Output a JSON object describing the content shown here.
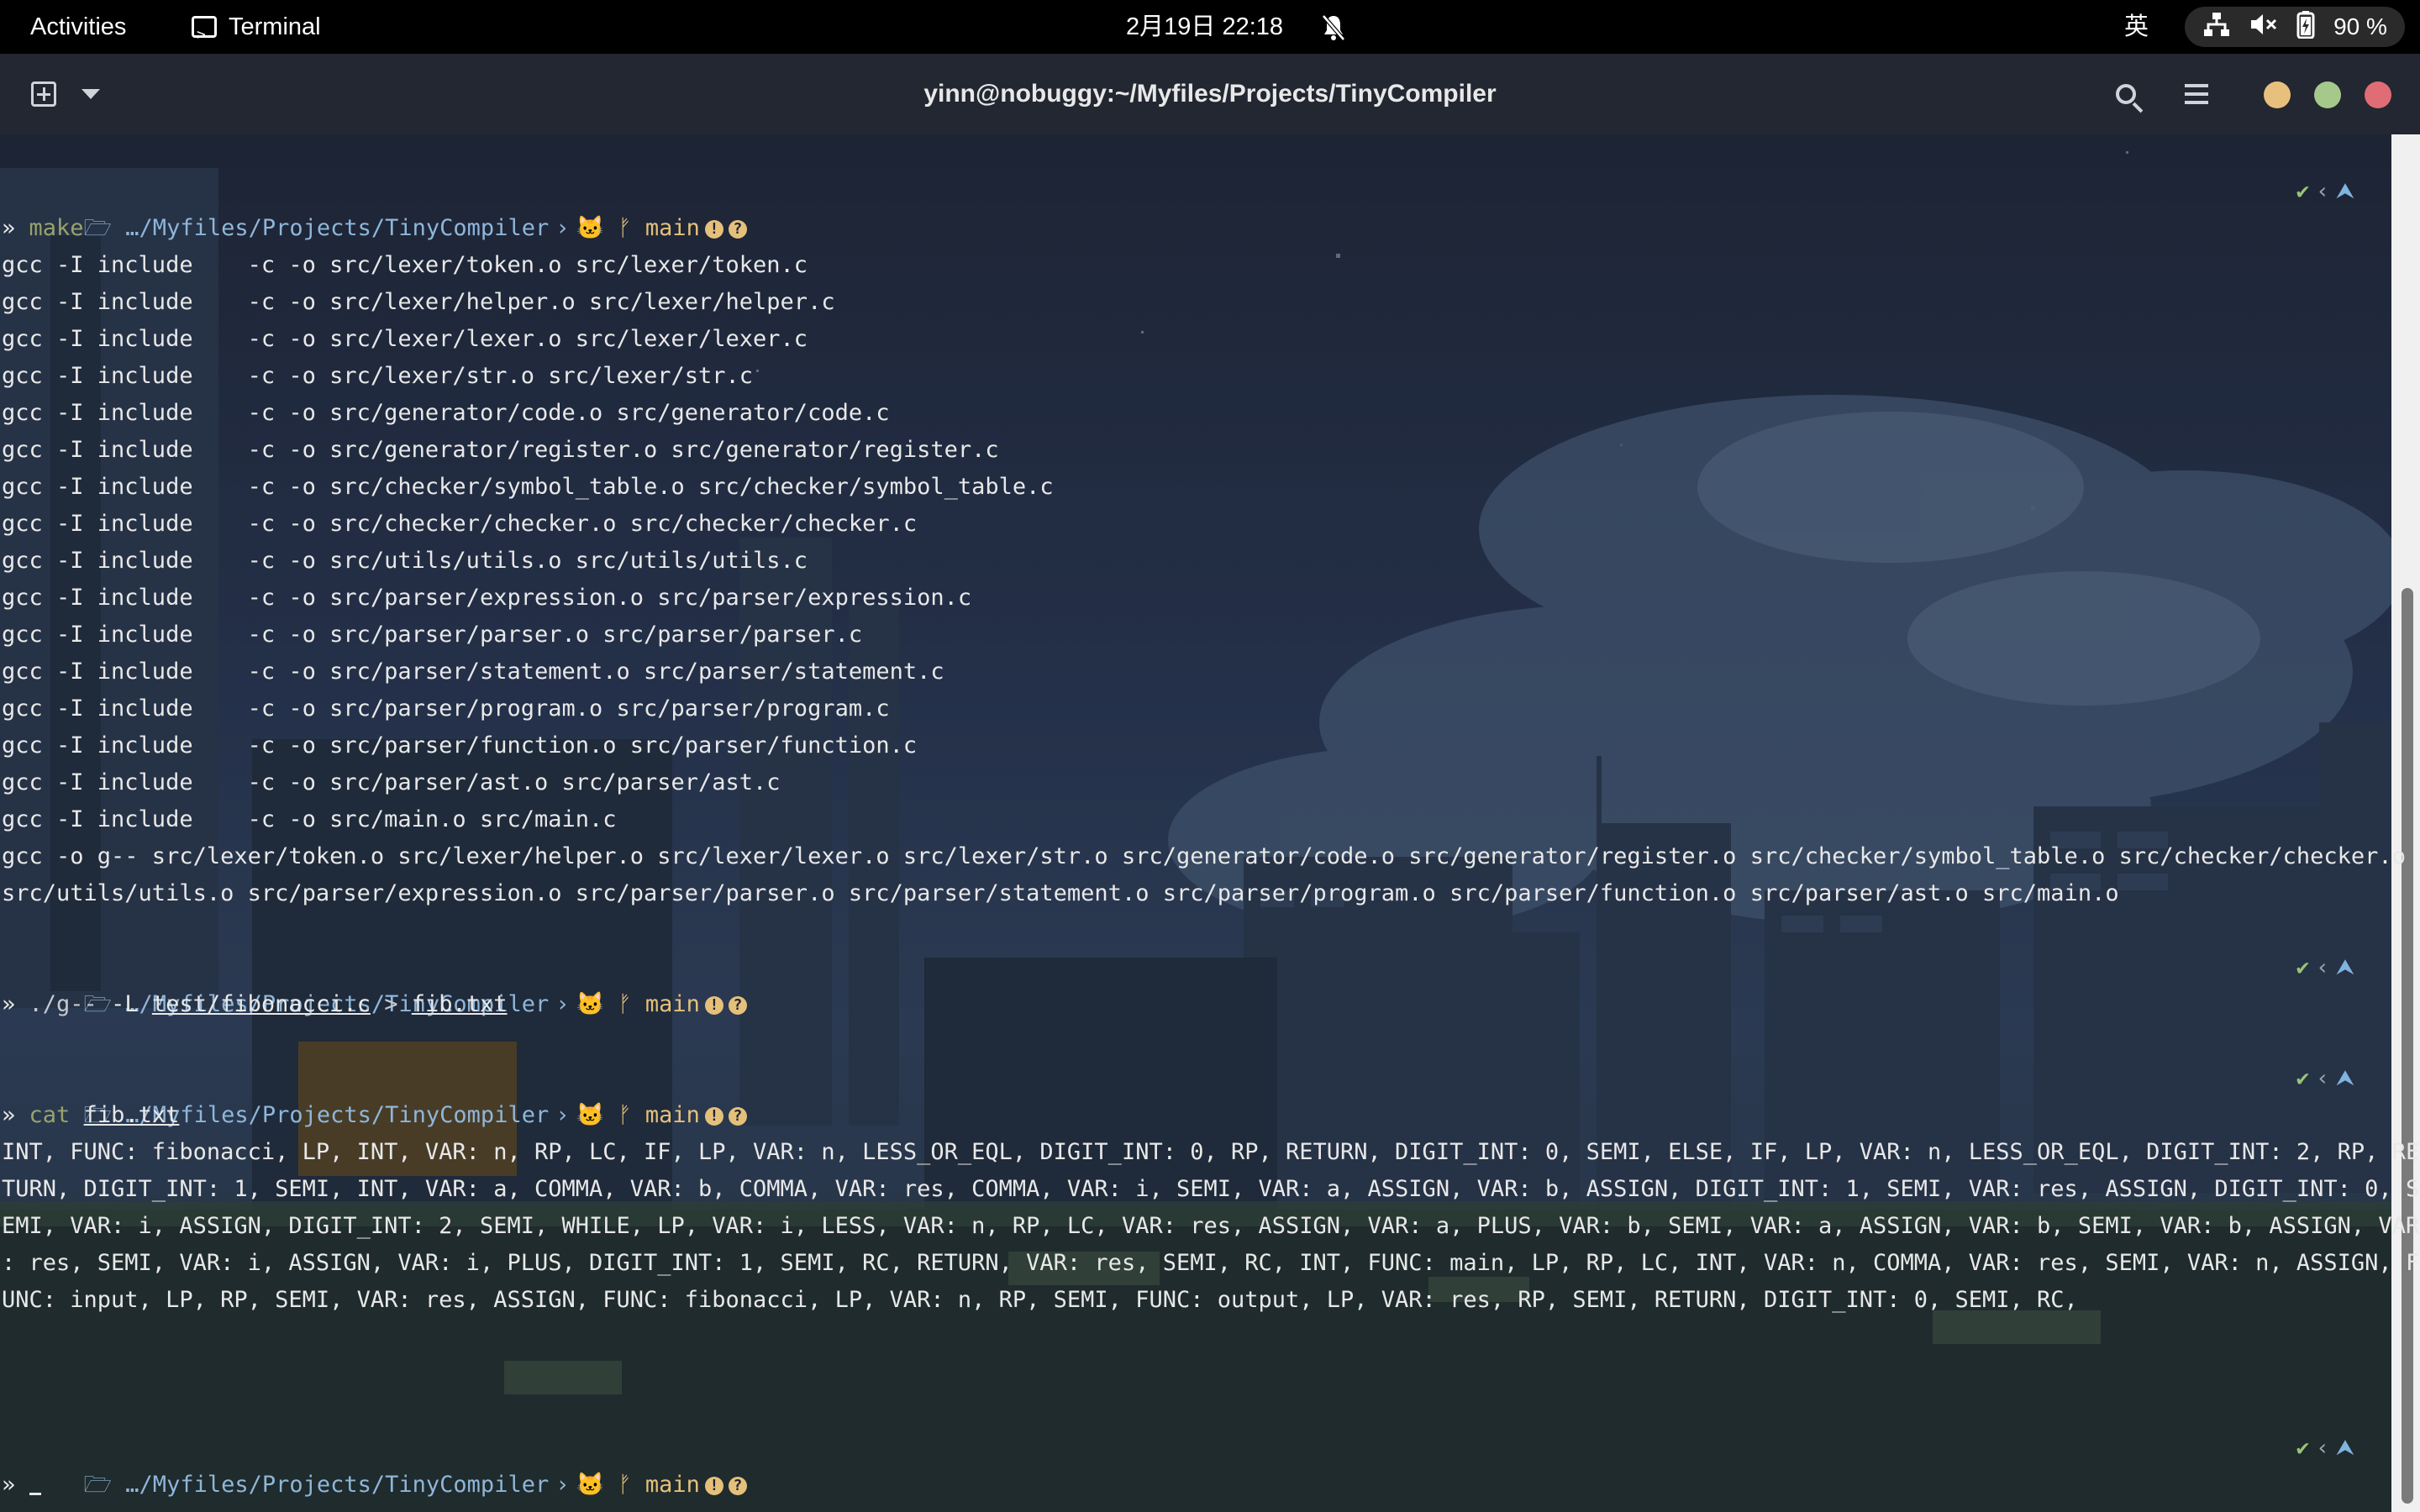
{
  "topbar": {
    "activities": "Activities",
    "app_name": "Terminal",
    "clock": "2月19日  22:18",
    "ime": "英",
    "battery": "90 %"
  },
  "window": {
    "title": "yinn@nobuggy:~/Myfiles/Projects/TinyCompiler"
  },
  "prompt": {
    "path": "…/Myfiles/Projects/TinyCompiler",
    "branch": "main"
  },
  "terminal": {
    "cmd1": "make",
    "build_lines": [
      "gcc -I include    -c -o src/lexer/token.o src/lexer/token.c",
      "gcc -I include    -c -o src/lexer/helper.o src/lexer/helper.c",
      "gcc -I include    -c -o src/lexer/lexer.o src/lexer/lexer.c",
      "gcc -I include    -c -o src/lexer/str.o src/lexer/str.c",
      "gcc -I include    -c -o src/generator/code.o src/generator/code.c",
      "gcc -I include    -c -o src/generator/register.o src/generator/register.c",
      "gcc -I include    -c -o src/checker/symbol_table.o src/checker/symbol_table.c",
      "gcc -I include    -c -o src/checker/checker.o src/checker/checker.c",
      "gcc -I include    -c -o src/utils/utils.o src/utils/utils.c",
      "gcc -I include    -c -o src/parser/expression.o src/parser/expression.c",
      "gcc -I include    -c -o src/parser/parser.o src/parser/parser.c",
      "gcc -I include    -c -o src/parser/statement.o src/parser/statement.c",
      "gcc -I include    -c -o src/parser/program.o src/parser/program.c",
      "gcc -I include    -c -o src/parser/function.o src/parser/function.c",
      "gcc -I include    -c -o src/parser/ast.o src/parser/ast.c",
      "gcc -I include    -c -o src/main.o src/main.c",
      "gcc -o g-- src/lexer/token.o src/lexer/helper.o src/lexer/lexer.o src/lexer/str.o src/generator/code.o src/generator/register.o src/checker/symbol_table.o src/checker/checker.o",
      "src/utils/utils.o src/parser/expression.o src/parser/parser.o src/parser/statement.o src/parser/program.o src/parser/function.o src/parser/ast.o src/main.o"
    ],
    "cmd2_exec": "./g--",
    "cmd2_flag": "-L",
    "cmd2_file": "test/fibonacci.c",
    "cmd2_redirect": ">",
    "cmd2_out": "fib.txt",
    "cmd3": "cat",
    "cmd3_file": "fib.txt",
    "output_lines": [
      "INT, FUNC: fibonacci, LP, INT, VAR: n, RP, LC, IF, LP, VAR: n, LESS_OR_EQL, DIGIT_INT: 0, RP, RETURN, DIGIT_INT: 0, SEMI, ELSE, IF, LP, VAR: n, LESS_OR_EQL, DIGIT_INT: 2, RP, RE",
      "TURN, DIGIT_INT: 1, SEMI, INT, VAR: a, COMMA, VAR: b, COMMA, VAR: res, COMMA, VAR: i, SEMI, VAR: a, ASSIGN, VAR: b, ASSIGN, DIGIT_INT: 1, SEMI, VAR: res, ASSIGN, DIGIT_INT: 0, S",
      "EMI, VAR: i, ASSIGN, DIGIT_INT: 2, SEMI, WHILE, LP, VAR: i, LESS, VAR: n, RP, LC, VAR: res, ASSIGN, VAR: a, PLUS, VAR: b, SEMI, VAR: a, ASSIGN, VAR: b, SEMI, VAR: b, ASSIGN, VAR",
      ": res, SEMI, VAR: i, ASSIGN, VAR: i, PLUS, DIGIT_INT: 1, SEMI, RC, RETURN, VAR: res, SEMI, RC, INT, FUNC: main, LP, RP, LC, INT, VAR: n, COMMA, VAR: res, SEMI, VAR: n, ASSIGN, F",
      "UNC: input, LP, RP, SEMI, VAR: res, ASSIGN, FUNC: fibonacci, LP, VAR: n, RP, SEMI, FUNC: output, LP, VAR: res, RP, SEMI, RETURN, DIGIT_INT: 0, SEMI, RC,"
    ],
    "prompt_symbol": "»"
  },
  "colors": {
    "prompt_path": "#8fb6d9",
    "branch": "#e5c07b",
    "ok": "#98c379",
    "close": "#e06c75",
    "minimize": "#e8c07d",
    "maximize": "#a5c98a"
  }
}
